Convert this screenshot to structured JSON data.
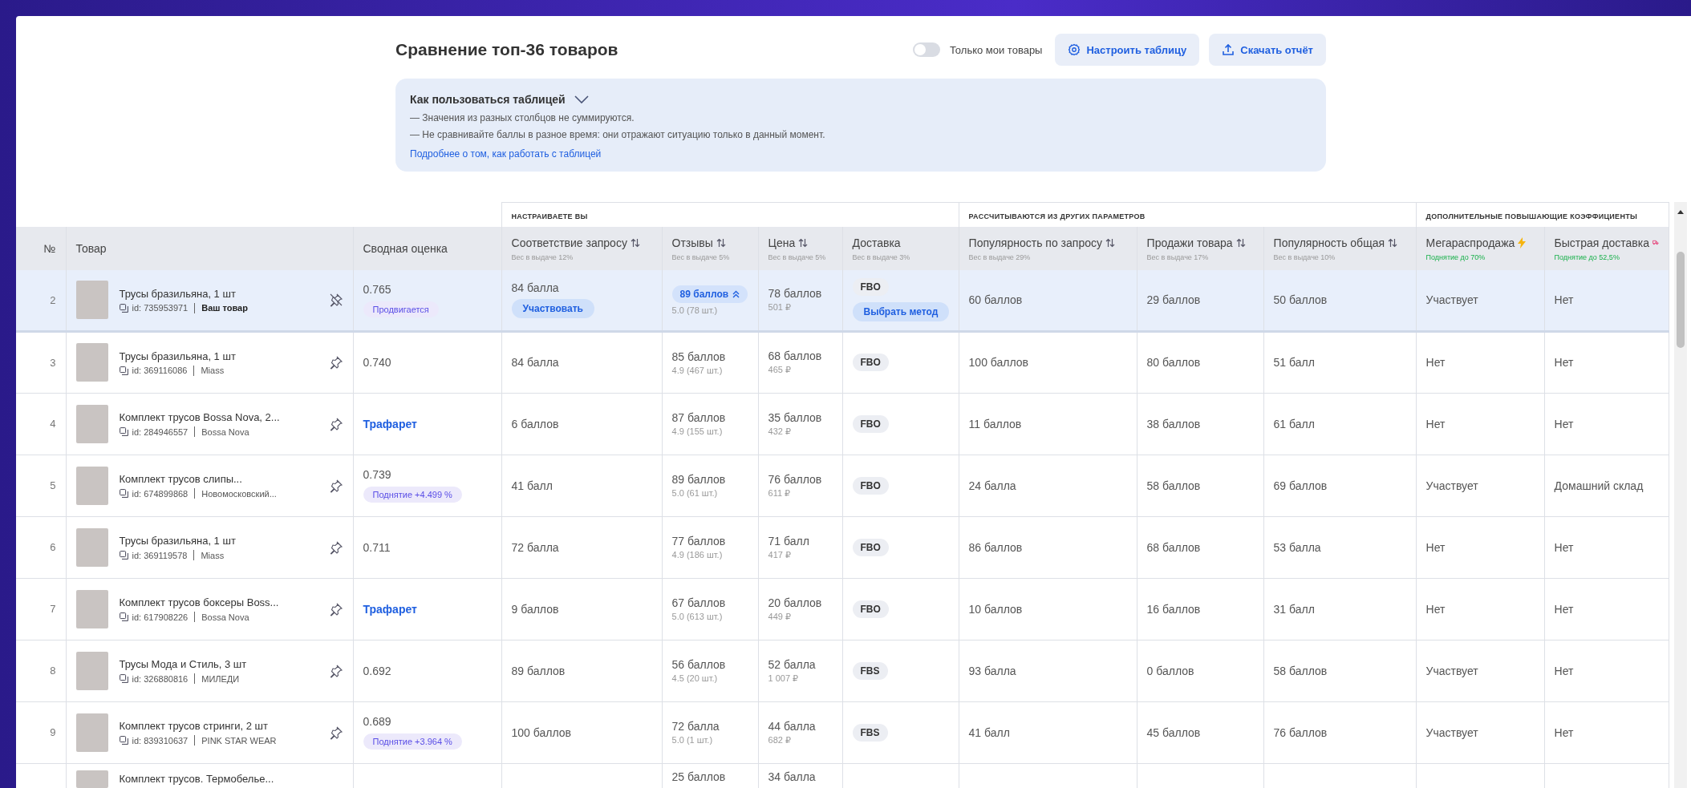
{
  "header": {
    "title": "Сравнение топ-36 товаров",
    "toggle": {
      "label": "Только мои товары",
      "on": false
    },
    "buttons": [
      {
        "kind": "settings",
        "label": "Настроить таблицу"
      },
      {
        "kind": "download",
        "label": "Скачать отчёт"
      }
    ]
  },
  "help": {
    "title": "Как пользоваться таблицей",
    "expanded": true,
    "lines": [
      "— Значения из разных столбцов не суммируются.",
      "— Не сравнивайте баллы в разное время: они отражают ситуацию только в данный момент."
    ],
    "link": "Подробнее о том, как работать с таблицей"
  },
  "table": {
    "groups": [
      {
        "kind": "base",
        "columns": [
          {
            "kind": "number",
            "label": "№",
            "sortable": false
          },
          {
            "kind": "product",
            "label": "Товар",
            "sortable": false
          },
          {
            "kind": "summary",
            "label": "Сводная оценка",
            "sortable": false
          }
        ]
      },
      {
        "kind": "custom",
        "label": "НАСТРАИВАЕТЕ ВЫ",
        "columns": [
          {
            "kind": "score",
            "label": "Соответствие запросу",
            "sortable": true,
            "note": "Вес в выдаче 12%"
          },
          {
            "kind": "score",
            "label": "Отзывы",
            "sortable": true,
            "note": "Вес в выдаче 5%"
          },
          {
            "kind": "score",
            "label": "Цена",
            "sortable": true,
            "note": "Вес в выдаче 5%"
          },
          {
            "kind": "score",
            "label": "Доставка",
            "sortable": false,
            "note": "Вес в выдаче 3%"
          }
        ]
      },
      {
        "kind": "computed",
        "label": "РАССЧИТЫВАЮТСЯ ИЗ ДРУГИХ ПАРАМЕТРОВ",
        "columns": [
          {
            "kind": "score",
            "label": "Популярность по запросу",
            "sortable": true,
            "note": "Вес в выдаче 29%"
          },
          {
            "kind": "score",
            "label": "Продажи товара",
            "sortable": true,
            "note": "Вес в выдаче 17%"
          },
          {
            "kind": "score",
            "label": "Популярность общая",
            "sortable": true,
            "note": "Вес в выдаче 10%"
          }
        ]
      },
      {
        "kind": "boost",
        "label": "ДОПОЛНИТЕЛЬНЫЕ ПОВЫШАЮЩИЕ КОЭФФИЦИЕНТЫ",
        "columns": [
          {
            "kind": "sale",
            "label": "Мегараспродажа",
            "sortable": false,
            "note": "Поднятие до 70%"
          },
          {
            "kind": "fast",
            "label": "Быстрая доставка",
            "sortable": false,
            "note": "Поднятие до 52,5%"
          }
        ]
      }
    ],
    "rows": [
      {
        "num": "2",
        "own": true,
        "pinned": true,
        "name": "Трусы бразильяна, 1 шт",
        "id": "id: 735953971",
        "seller": "Ваш товар",
        "summary": {
          "kind": "score",
          "value": "0.765",
          "badge": "Продвигается"
        },
        "relevance": "84 балла",
        "relevance_action": "Участвовать",
        "reviews": {
          "score": "89 баллов",
          "sub": "5.0 (78 шт.)",
          "boosted": true
        },
        "price": {
          "score": "78 баллов",
          "sub": "501 ₽"
        },
        "delivery": "FBO",
        "delivery_action": "Выбрать метод",
        "query_popularity": "60 баллов",
        "sales": "29 баллов",
        "total_popularity": "50 баллов",
        "megasale": "Участвует",
        "fast_delivery": "Нет"
      },
      {
        "num": "3",
        "own": false,
        "pinned": false,
        "name": "Трусы бразильяна, 1 шт",
        "id": "id: 369116086",
        "seller": "Miass",
        "summary": {
          "kind": "score",
          "value": "0.740"
        },
        "relevance": "84 балла",
        "reviews": {
          "score": "85 баллов",
          "sub": "4.9 (467 шт.)",
          "boosted": false
        },
        "price": {
          "score": "68 баллов",
          "sub": "465 ₽"
        },
        "delivery": "FBO",
        "query_popularity": "100 баллов",
        "sales": "80 баллов",
        "total_popularity": "51 балл",
        "megasale": "Нет",
        "fast_delivery": "Нет"
      },
      {
        "num": "4",
        "own": false,
        "pinned": false,
        "name": "Комплект трусов Bossa Nova, 2...",
        "id": "id: 284946557",
        "seller": "Bossa Nova",
        "summary": {
          "kind": "link",
          "value": "Трафарет"
        },
        "relevance": "6 баллов",
        "reviews": {
          "score": "87 баллов",
          "sub": "4.9 (155 шт.)",
          "boosted": false
        },
        "price": {
          "score": "35 баллов",
          "sub": "432 ₽"
        },
        "delivery": "FBO",
        "query_popularity": "11 баллов",
        "sales": "38 баллов",
        "total_popularity": "61 балл",
        "megasale": "Нет",
        "fast_delivery": "Нет"
      },
      {
        "num": "5",
        "own": false,
        "pinned": false,
        "name": "Комплект трусов слипы...",
        "id": "id: 674899868",
        "seller": "Новомосковский...",
        "summary": {
          "kind": "score",
          "value": "0.739",
          "badge": "Поднятие +4.499 %"
        },
        "relevance": "41 балл",
        "reviews": {
          "score": "89 баллов",
          "sub": "5.0 (61 шт.)",
          "boosted": false
        },
        "price": {
          "score": "76 баллов",
          "sub": "611 ₽"
        },
        "delivery": "FBO",
        "query_popularity": "24 балла",
        "sales": "58 баллов",
        "total_popularity": "69 баллов",
        "megasale": "Участвует",
        "fast_delivery": "Домашний склад"
      },
      {
        "num": "6",
        "own": false,
        "pinned": false,
        "name": "Трусы бразильяна, 1 шт",
        "id": "id: 369119578",
        "seller": "Miass",
        "summary": {
          "kind": "score",
          "value": "0.711"
        },
        "relevance": "72 балла",
        "reviews": {
          "score": "77 баллов",
          "sub": "4.9 (186 шт.)",
          "boosted": false
        },
        "price": {
          "score": "71 балл",
          "sub": "417 ₽"
        },
        "delivery": "FBO",
        "query_popularity": "86 баллов",
        "sales": "68 баллов",
        "total_popularity": "53 балла",
        "megasale": "Нет",
        "fast_delivery": "Нет"
      },
      {
        "num": "7",
        "own": false,
        "pinned": false,
        "name": "Комплект трусов боксеры Boss...",
        "id": "id: 617908226",
        "seller": "Bossa Nova",
        "summary": {
          "kind": "link",
          "value": "Трафарет"
        },
        "relevance": "9 баллов",
        "reviews": {
          "score": "67 баллов",
          "sub": "5.0 (613 шт.)",
          "boosted": false
        },
        "price": {
          "score": "20 баллов",
          "sub": "449 ₽"
        },
        "delivery": "FBO",
        "query_popularity": "10 баллов",
        "sales": "16 баллов",
        "total_popularity": "31 балл",
        "megasale": "Нет",
        "fast_delivery": "Нет"
      },
      {
        "num": "8",
        "own": false,
        "pinned": false,
        "name": "Трусы Мода и Стиль, 3 шт",
        "id": "id: 326880816",
        "seller": "МИЛЕДИ",
        "summary": {
          "kind": "score",
          "value": "0.692"
        },
        "relevance": "89 баллов",
        "reviews": {
          "score": "56 баллов",
          "sub": "4.5 (20 шт.)",
          "boosted": false
        },
        "price": {
          "score": "52 балла",
          "sub": "1 007 ₽"
        },
        "delivery": "FBS",
        "query_popularity": "93 балла",
        "sales": "0 баллов",
        "total_popularity": "58 баллов",
        "megasale": "Участвует",
        "fast_delivery": "Нет"
      },
      {
        "num": "9",
        "own": false,
        "pinned": false,
        "name": "Комплект трусов стринги, 2 шт",
        "id": "id: 839310637",
        "seller": "PINK STAR WEAR",
        "summary": {
          "kind": "score",
          "value": "0.689",
          "badge": "Поднятие +3.964 %"
        },
        "relevance": "100 баллов",
        "reviews": {
          "score": "72 балла",
          "sub": "5.0 (1 шт.)",
          "boosted": false
        },
        "price": {
          "score": "44 балла",
          "sub": "682 ₽"
        },
        "delivery": "FBS",
        "query_popularity": "41 балл",
        "sales": "45 баллов",
        "total_popularity": "76 баллов",
        "megasale": "Участвует",
        "fast_delivery": "Нет"
      }
    ],
    "partial_row": {
      "name": "Комплект трусов. Термобелье...",
      "reviews": "25 баллов",
      "price": "34 балла"
    }
  }
}
